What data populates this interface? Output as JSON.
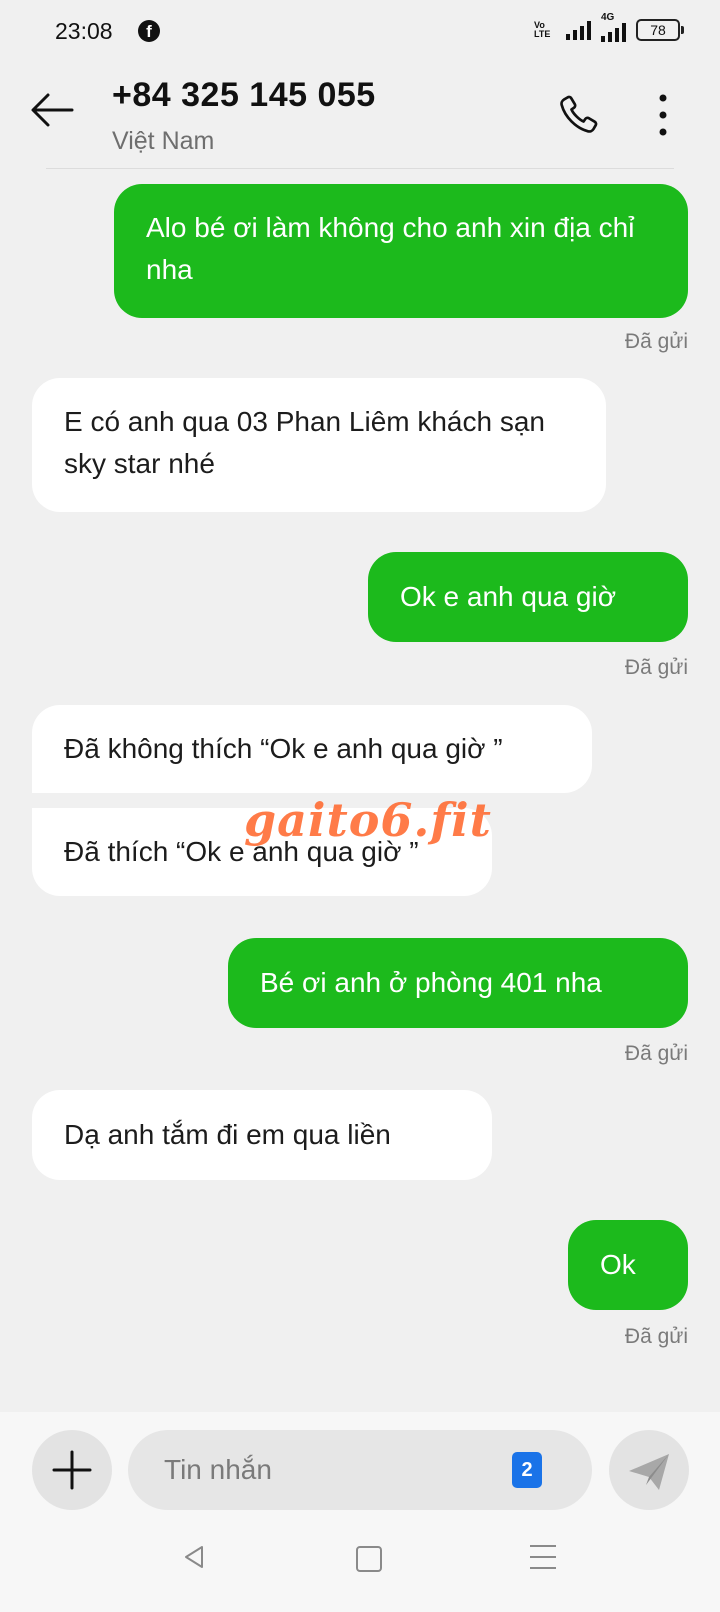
{
  "status_bar": {
    "time": "23:08",
    "notification_icon": "facebook-icon",
    "volte_label": "Vo LTE",
    "network_label": "4G",
    "battery_level": "78"
  },
  "header": {
    "contact_number": "+84 325 145 055",
    "contact_region": "Việt Nam",
    "icons": [
      "back-arrow-icon",
      "phone-icon",
      "more-vertical-icon"
    ]
  },
  "messages": [
    {
      "direction": "out",
      "text": "Alo bé ơi làm không cho anh xin địa chỉ nha",
      "status": "Đã gửi"
    },
    {
      "direction": "in",
      "text": "E có anh qua 03 Phan Liêm khách sạn sky star nhé"
    },
    {
      "direction": "out",
      "text": "Ok e anh qua giờ",
      "status": "Đã gửi"
    },
    {
      "direction": "in",
      "text": "Đã không thích “Ok e anh qua giờ ”"
    },
    {
      "direction": "in",
      "text": "Đã thích “Ok e anh qua giờ ”"
    },
    {
      "direction": "out",
      "text": "Bé ơi anh ở phòng 401 nha",
      "status": "Đã gửi"
    },
    {
      "direction": "in",
      "text": "Dạ anh tắm đi em qua liền"
    },
    {
      "direction": "out",
      "text": "Ok",
      "status": "Đã gửi"
    }
  ],
  "watermark": "gaito6.fit",
  "composer": {
    "placeholder": "Tin nhắn",
    "sim_slot": "2",
    "icons": [
      "plus-icon",
      "send-icon"
    ]
  },
  "colors": {
    "outgoing_bubble": "#1cba1c",
    "incoming_bubble": "#ffffff",
    "background": "#f0f0f0",
    "sim_badge": "#1a73e8"
  }
}
